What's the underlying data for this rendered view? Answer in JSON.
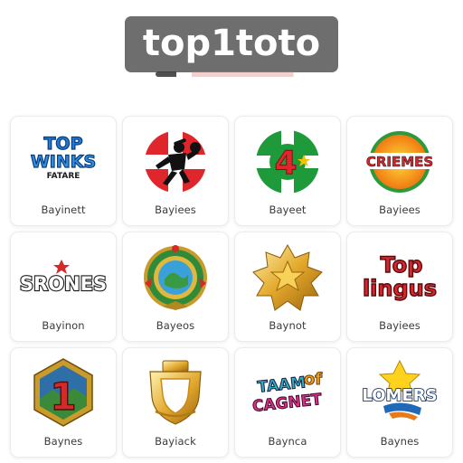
{
  "brand": {
    "title": "top1toto"
  },
  "colors": {
    "brand_bg": "#6e6e6e",
    "card_border": "#ececec",
    "label_text": "#3a3a3a"
  },
  "cards": [
    {
      "label": "Bayinett",
      "logo_text": "TOP",
      "logo_text_2": "WINKS",
      "logo_text_3": "FATARE",
      "icon": "top-winks-logo"
    },
    {
      "label": "Bayiees",
      "icon": "burglar-cross-icon"
    },
    {
      "label": "Bayeet",
      "logo_text": "4",
      "icon": "number-four-badge-icon"
    },
    {
      "label": "Bayiees",
      "logo_text": "CRIEMES",
      "icon": "criemes-sun-logo"
    },
    {
      "label": "Bayinon",
      "logo_text": "SRONES",
      "icon": "srones-logo"
    },
    {
      "label": "Bayeos",
      "icon": "ornate-globe-emblem-icon"
    },
    {
      "label": "Baynot",
      "icon": "gold-star-medal-icon"
    },
    {
      "label": "Bayiees",
      "logo_text": "Top",
      "logo_text_2": "lingus",
      "icon": "top-lingus-logo"
    },
    {
      "label": "Baynes",
      "logo_text": "1",
      "icon": "hexagon-one-badge-icon"
    },
    {
      "label": "Bayiack",
      "icon": "gold-shield-crest-icon"
    },
    {
      "label": "Baynca",
      "logo_text": "TAAM",
      "logo_text_2": "CAGNET",
      "logo_text_3": "of",
      "icon": "taam-cagnet-logo"
    },
    {
      "label": "Baynes",
      "logo_text": "LOMERS",
      "icon": "lomers-star-logo"
    }
  ]
}
